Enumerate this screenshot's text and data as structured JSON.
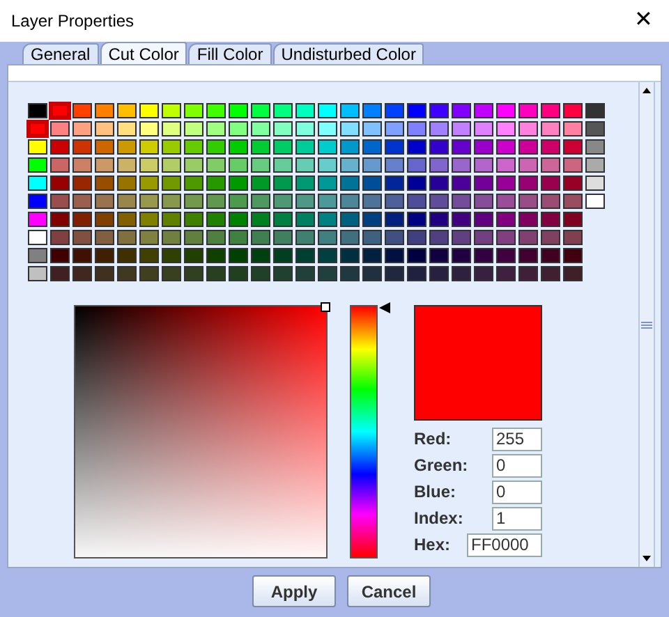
{
  "window": {
    "title": "Layer Properties",
    "close": "✕"
  },
  "tabs": [
    {
      "label": "General",
      "selected": false
    },
    {
      "label": "Cut Color",
      "selected": true
    },
    {
      "label": "Fill Color",
      "selected": false
    },
    {
      "label": "Undisturbed Color",
      "selected": false
    }
  ],
  "palette": {
    "columns": [
      {
        "kind": "fixed",
        "swatches": [
          {
            "color": "#000000",
            "selected": false
          },
          {
            "color": "#ff0000",
            "selected": true
          },
          {
            "color": "#ffff00",
            "selected": false
          },
          {
            "color": "#00ff00",
            "selected": false
          },
          {
            "color": "#00ffff",
            "selected": false
          },
          {
            "color": "#0000ff",
            "selected": false
          },
          {
            "color": "#ff00ff",
            "selected": false
          },
          {
            "color": "#ffffff",
            "selected": false
          },
          {
            "color": "#808080",
            "selected": false
          },
          {
            "color": "#c0c0c0",
            "selected": false
          }
        ]
      },
      {
        "kind": "shades",
        "color": "#ff0000",
        "swatches": [
          {
            "selected": true
          },
          {
            "selected": false
          },
          {
            "selected": false
          },
          {
            "selected": false
          },
          {
            "selected": false
          },
          {
            "selected": false
          },
          {
            "selected": false
          },
          {
            "selected": false
          },
          {
            "selected": false
          },
          {
            "selected": false
          }
        ]
      },
      {
        "kind": "shades",
        "color": "#ff4000",
        "swatches": [
          {
            "selected": false
          },
          {
            "selected": false
          },
          {
            "selected": false
          },
          {
            "selected": false
          },
          {
            "selected": false
          },
          {
            "selected": false
          },
          {
            "selected": false
          },
          {
            "selected": false
          },
          {
            "selected": false
          },
          {
            "selected": false
          }
        ]
      },
      {
        "kind": "shades",
        "color": "#ff8000",
        "swatches": [
          {
            "selected": false
          },
          {
            "selected": false
          },
          {
            "selected": false
          },
          {
            "selected": false
          },
          {
            "selected": false
          },
          {
            "selected": false
          },
          {
            "selected": false
          },
          {
            "selected": false
          },
          {
            "selected": false
          },
          {
            "selected": false
          }
        ]
      },
      {
        "kind": "shades",
        "color": "#ffbf00",
        "swatches": [
          {
            "selected": false
          },
          {
            "selected": false
          },
          {
            "selected": false
          },
          {
            "selected": false
          },
          {
            "selected": false
          },
          {
            "selected": false
          },
          {
            "selected": false
          },
          {
            "selected": false
          },
          {
            "selected": false
          },
          {
            "selected": false
          }
        ]
      },
      {
        "kind": "shades",
        "color": "#ffff00",
        "swatches": [
          {
            "selected": false
          },
          {
            "selected": false
          },
          {
            "selected": false
          },
          {
            "selected": false
          },
          {
            "selected": false
          },
          {
            "selected": false
          },
          {
            "selected": false
          },
          {
            "selected": false
          },
          {
            "selected": false
          },
          {
            "selected": false
          }
        ]
      },
      {
        "kind": "shades",
        "color": "#bfff00",
        "swatches": [
          {
            "selected": false
          },
          {
            "selected": false
          },
          {
            "selected": false
          },
          {
            "selected": false
          },
          {
            "selected": false
          },
          {
            "selected": false
          },
          {
            "selected": false
          },
          {
            "selected": false
          },
          {
            "selected": false
          },
          {
            "selected": false
          }
        ]
      },
      {
        "kind": "shades",
        "color": "#80ff00",
        "swatches": [
          {
            "selected": false
          },
          {
            "selected": false
          },
          {
            "selected": false
          },
          {
            "selected": false
          },
          {
            "selected": false
          },
          {
            "selected": false
          },
          {
            "selected": false
          },
          {
            "selected": false
          },
          {
            "selected": false
          },
          {
            "selected": false
          }
        ]
      },
      {
        "kind": "shades",
        "color": "#40ff00",
        "swatches": [
          {
            "selected": false
          },
          {
            "selected": false
          },
          {
            "selected": false
          },
          {
            "selected": false
          },
          {
            "selected": false
          },
          {
            "selected": false
          },
          {
            "selected": false
          },
          {
            "selected": false
          },
          {
            "selected": false
          },
          {
            "selected": false
          }
        ]
      },
      {
        "kind": "shades",
        "color": "#00ff00",
        "swatches": [
          {
            "selected": false
          },
          {
            "selected": false
          },
          {
            "selected": false
          },
          {
            "selected": false
          },
          {
            "selected": false
          },
          {
            "selected": false
          },
          {
            "selected": false
          },
          {
            "selected": false
          },
          {
            "selected": false
          },
          {
            "selected": false
          }
        ]
      },
      {
        "kind": "shades",
        "color": "#00ff40",
        "swatches": [
          {
            "selected": false
          },
          {
            "selected": false
          },
          {
            "selected": false
          },
          {
            "selected": false
          },
          {
            "selected": false
          },
          {
            "selected": false
          },
          {
            "selected": false
          },
          {
            "selected": false
          },
          {
            "selected": false
          },
          {
            "selected": false
          }
        ]
      },
      {
        "kind": "shades",
        "color": "#00ff80",
        "swatches": [
          {
            "selected": false
          },
          {
            "selected": false
          },
          {
            "selected": false
          },
          {
            "selected": false
          },
          {
            "selected": false
          },
          {
            "selected": false
          },
          {
            "selected": false
          },
          {
            "selected": false
          },
          {
            "selected": false
          },
          {
            "selected": false
          }
        ]
      },
      {
        "kind": "shades",
        "color": "#00ffbf",
        "swatches": [
          {
            "selected": false
          },
          {
            "selected": false
          },
          {
            "selected": false
          },
          {
            "selected": false
          },
          {
            "selected": false
          },
          {
            "selected": false
          },
          {
            "selected": false
          },
          {
            "selected": false
          },
          {
            "selected": false
          },
          {
            "selected": false
          }
        ]
      },
      {
        "kind": "shades",
        "color": "#00ffff",
        "swatches": [
          {
            "selected": false
          },
          {
            "selected": false
          },
          {
            "selected": false
          },
          {
            "selected": false
          },
          {
            "selected": false
          },
          {
            "selected": false
          },
          {
            "selected": false
          },
          {
            "selected": false
          },
          {
            "selected": false
          },
          {
            "selected": false
          }
        ]
      },
      {
        "kind": "shades",
        "color": "#00bfff",
        "swatches": [
          {
            "selected": false
          },
          {
            "selected": false
          },
          {
            "selected": false
          },
          {
            "selected": false
          },
          {
            "selected": false
          },
          {
            "selected": false
          },
          {
            "selected": false
          },
          {
            "selected": false
          },
          {
            "selected": false
          },
          {
            "selected": false
          }
        ]
      },
      {
        "kind": "shades",
        "color": "#0080ff",
        "swatches": [
          {
            "selected": false
          },
          {
            "selected": false
          },
          {
            "selected": false
          },
          {
            "selected": false
          },
          {
            "selected": false
          },
          {
            "selected": false
          },
          {
            "selected": false
          },
          {
            "selected": false
          },
          {
            "selected": false
          },
          {
            "selected": false
          }
        ]
      },
      {
        "kind": "shades",
        "color": "#0040ff",
        "swatches": [
          {
            "selected": false
          },
          {
            "selected": false
          },
          {
            "selected": false
          },
          {
            "selected": false
          },
          {
            "selected": false
          },
          {
            "selected": false
          },
          {
            "selected": false
          },
          {
            "selected": false
          },
          {
            "selected": false
          },
          {
            "selected": false
          }
        ]
      },
      {
        "kind": "shades",
        "color": "#0000ff",
        "swatches": [
          {
            "selected": false
          },
          {
            "selected": false
          },
          {
            "selected": false
          },
          {
            "selected": false
          },
          {
            "selected": false
          },
          {
            "selected": false
          },
          {
            "selected": false
          },
          {
            "selected": false
          },
          {
            "selected": false
          },
          {
            "selected": false
          }
        ]
      },
      {
        "kind": "shades",
        "color": "#4000ff",
        "swatches": [
          {
            "selected": false
          },
          {
            "selected": false
          },
          {
            "selected": false
          },
          {
            "selected": false
          },
          {
            "selected": false
          },
          {
            "selected": false
          },
          {
            "selected": false
          },
          {
            "selected": false
          },
          {
            "selected": false
          },
          {
            "selected": false
          }
        ]
      },
      {
        "kind": "shades",
        "color": "#8000ff",
        "swatches": [
          {
            "selected": false
          },
          {
            "selected": false
          },
          {
            "selected": false
          },
          {
            "selected": false
          },
          {
            "selected": false
          },
          {
            "selected": false
          },
          {
            "selected": false
          },
          {
            "selected": false
          },
          {
            "selected": false
          },
          {
            "selected": false
          }
        ]
      },
      {
        "kind": "shades",
        "color": "#bf00ff",
        "swatches": [
          {
            "selected": false
          },
          {
            "selected": false
          },
          {
            "selected": false
          },
          {
            "selected": false
          },
          {
            "selected": false
          },
          {
            "selected": false
          },
          {
            "selected": false
          },
          {
            "selected": false
          },
          {
            "selected": false
          },
          {
            "selected": false
          }
        ]
      },
      {
        "kind": "shades",
        "color": "#ff00ff",
        "swatches": [
          {
            "selected": false
          },
          {
            "selected": false
          },
          {
            "selected": false
          },
          {
            "selected": false
          },
          {
            "selected": false
          },
          {
            "selected": false
          },
          {
            "selected": false
          },
          {
            "selected": false
          },
          {
            "selected": false
          },
          {
            "selected": false
          }
        ]
      },
      {
        "kind": "shades",
        "color": "#ff00bf",
        "swatches": [
          {
            "selected": false
          },
          {
            "selected": false
          },
          {
            "selected": false
          },
          {
            "selected": false
          },
          {
            "selected": false
          },
          {
            "selected": false
          },
          {
            "selected": false
          },
          {
            "selected": false
          },
          {
            "selected": false
          },
          {
            "selected": false
          }
        ]
      },
      {
        "kind": "shades",
        "color": "#ff0080",
        "swatches": [
          {
            "selected": false
          },
          {
            "selected": false
          },
          {
            "selected": false
          },
          {
            "selected": false
          },
          {
            "selected": false
          },
          {
            "selected": false
          },
          {
            "selected": false
          },
          {
            "selected": false
          },
          {
            "selected": false
          },
          {
            "selected": false
          }
        ]
      },
      {
        "kind": "shades",
        "color": "#ff0040",
        "swatches": [
          {
            "selected": false
          },
          {
            "selected": false
          },
          {
            "selected": false
          },
          {
            "selected": false
          },
          {
            "selected": false
          },
          {
            "selected": false
          },
          {
            "selected": false
          },
          {
            "selected": false
          },
          {
            "selected": false
          },
          {
            "selected": false
          }
        ]
      },
      {
        "kind": "fixed",
        "swatches": [
          {
            "color": "#333333",
            "selected": false
          },
          {
            "color": "#555555",
            "selected": false
          },
          {
            "color": "#888888",
            "selected": false
          },
          {
            "color": "#aaaaaa",
            "selected": false
          },
          {
            "color": "#dddddd",
            "selected": false
          },
          {
            "color": "#ffffff",
            "selected": false
          }
        ]
      }
    ]
  },
  "hue_slider": {
    "level": 0
  },
  "preview": {
    "color": "#ff0000"
  },
  "fields": [
    {
      "label": "Red:",
      "value": "255"
    },
    {
      "label": "Green:",
      "value": "0"
    },
    {
      "label": "Blue:",
      "value": "0"
    },
    {
      "label": "Index:",
      "value": "1"
    },
    {
      "label": "Hex:",
      "value": "FF0000",
      "kind": "wide"
    }
  ],
  "buttons": [
    "Apply",
    "Cancel"
  ]
}
